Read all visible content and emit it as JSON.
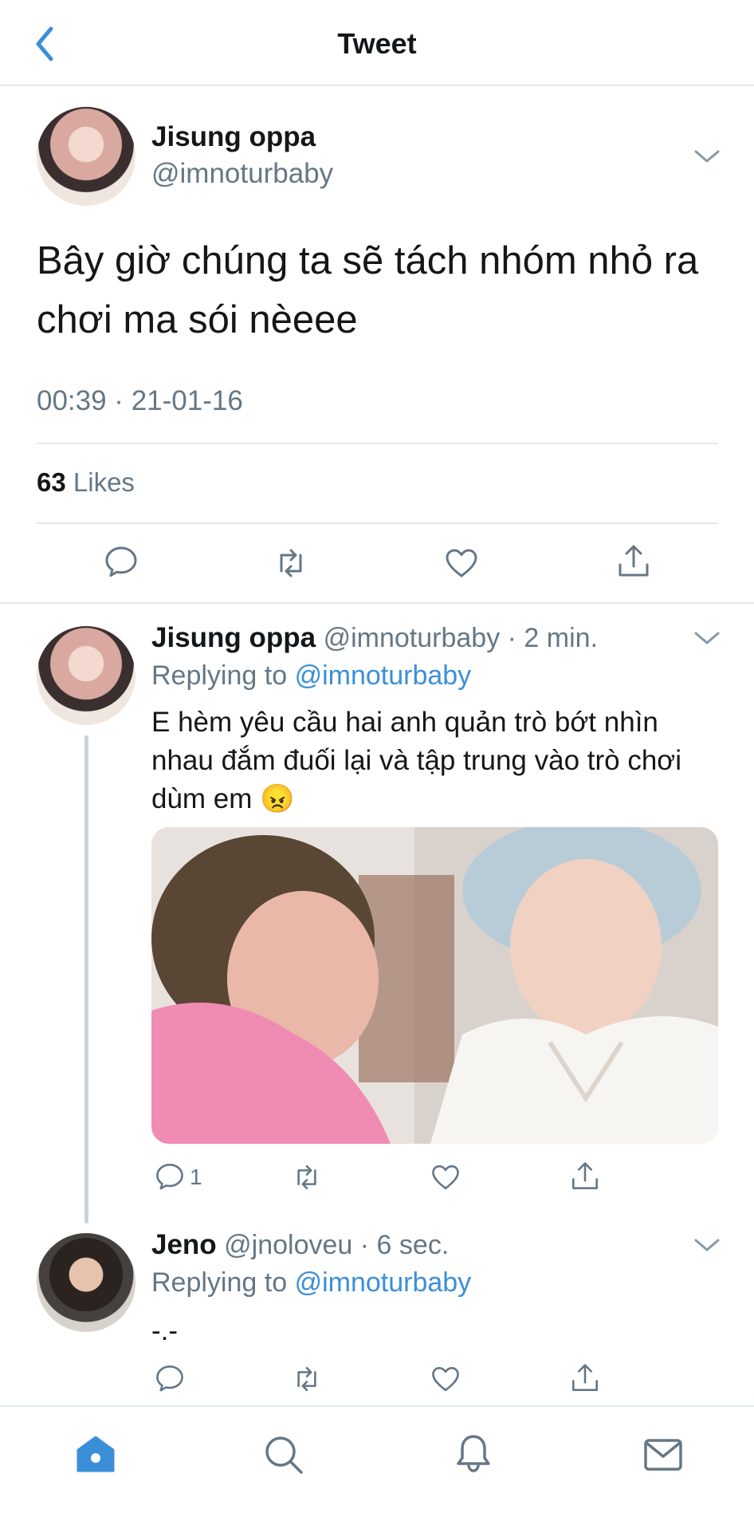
{
  "header": {
    "title": "Tweet"
  },
  "main_tweet": {
    "name": "Jisung oppa",
    "handle": "@imnoturbaby",
    "text_line1": "Bây giờ chúng ta sẽ tách nhóm nhỏ ra",
    "text_line2": "chơi ma sói nèeee",
    "timestamp": "00:39 · 21-01-16",
    "likes_count": "63",
    "likes_label": "Likes"
  },
  "reply1": {
    "name": "Jisung oppa",
    "handle": "@imnoturbaby",
    "time": "· 2 min.",
    "replying_prefix": "Replying to",
    "replying_to": "@imnoturbaby",
    "line1": "E hèm yêu cầu hai anh quản trò bớt nhìn",
    "line2": "nhau đắm đuối lại và tập trung vào trò chơi",
    "line3": "dùm em 😠",
    "reply_count": "1"
  },
  "reply2": {
    "name": "Jeno",
    "handle": "@jnoloveu",
    "time": "· 6 sec.",
    "replying_prefix": "Replying to",
    "replying_to": "@imnoturbaby",
    "text": "-.-"
  },
  "colors": {
    "accent": "#3b8fd8",
    "secondary_text": "#657786",
    "divider": "#e1e8ed",
    "tab_active": "#3b8fd8",
    "tab_inactive": "#657786"
  },
  "icons": [
    "back-chevron-icon",
    "chevron-down-icon",
    "reply-icon",
    "retweet-icon",
    "like-icon",
    "share-icon",
    "home-icon",
    "search-icon",
    "notifications-icon",
    "messages-icon"
  ]
}
